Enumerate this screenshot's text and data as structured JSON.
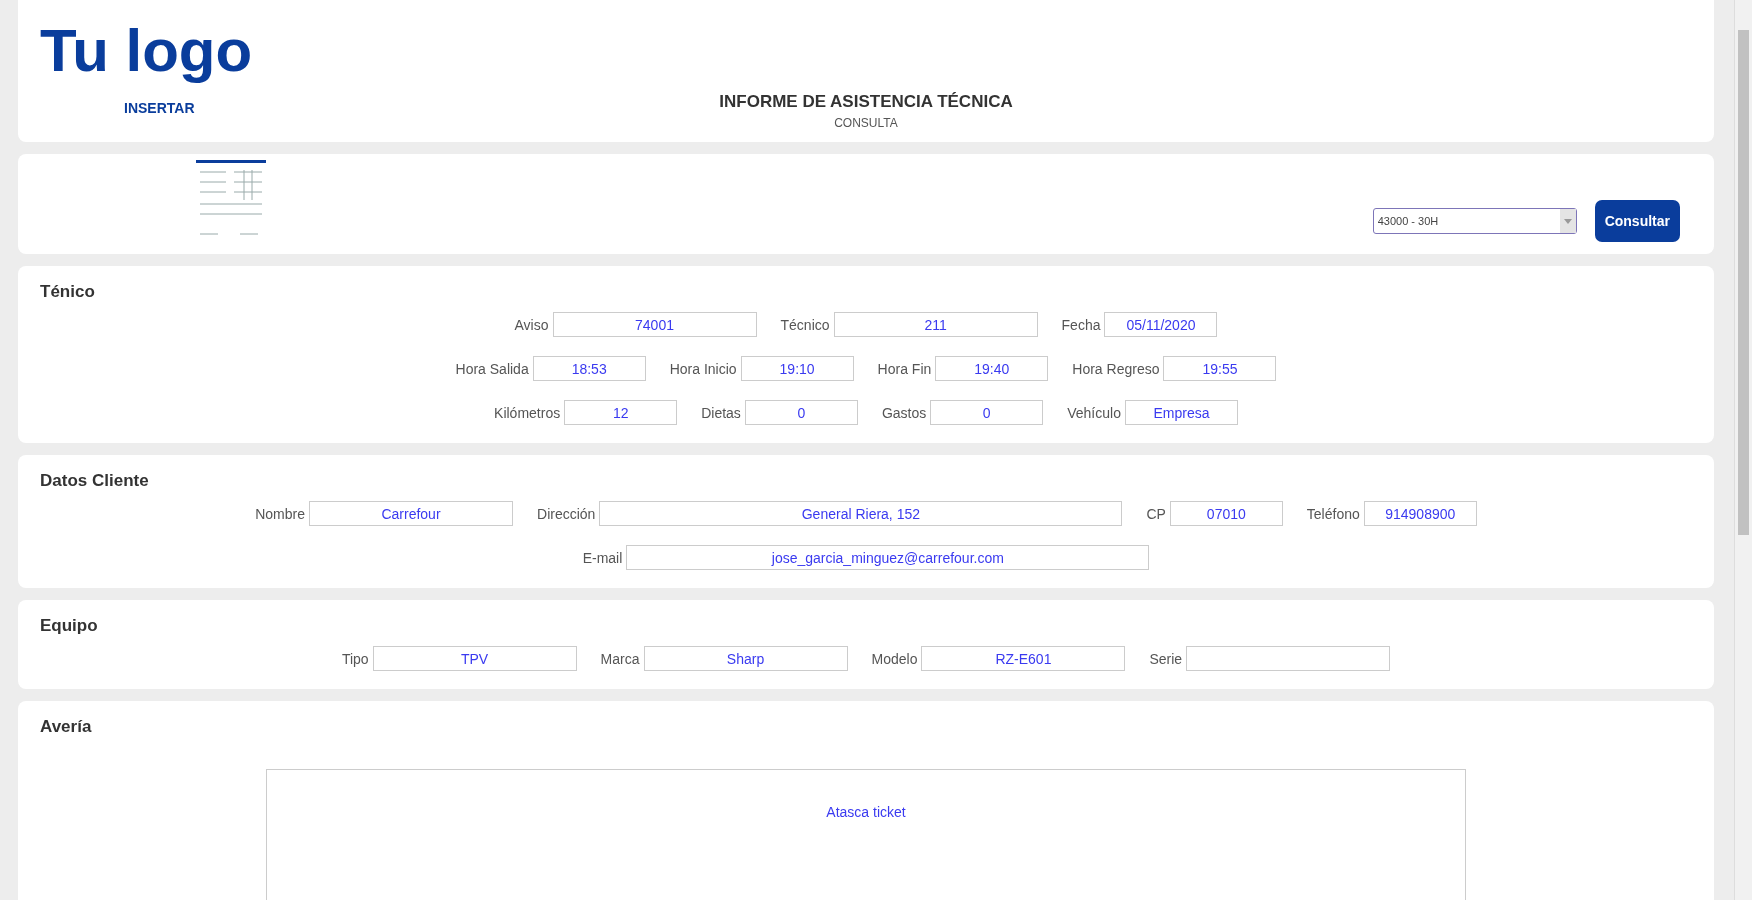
{
  "header": {
    "logo": "Tu logo",
    "insert_link": "INSERTAR",
    "title": "INFORME DE ASISTENCIA TÉCNICA",
    "subtitle": "CONSULTA"
  },
  "query": {
    "select_value": "43000 - 30H",
    "button": "Consultar"
  },
  "sections": [
    {
      "title": "Ténico",
      "lines": [
        {
          "fields": [
            {
              "label": "Aviso",
              "value": "74001",
              "kind": "medium"
            },
            {
              "label": "Técnico",
              "value": "211",
              "kind": "medium"
            },
            {
              "label": "Fecha",
              "value": "05/11/2020",
              "kind": "short"
            }
          ]
        },
        {
          "fields": [
            {
              "label": "Hora Salida",
              "value": "18:53",
              "kind": "short"
            },
            {
              "label": "Hora Inicio",
              "value": "19:10",
              "kind": "short"
            },
            {
              "label": "Hora Fin",
              "value": "19:40",
              "kind": "short"
            },
            {
              "label": "Hora Regreso",
              "value": "19:55",
              "kind": "short"
            }
          ]
        },
        {
          "fields": [
            {
              "label": "Kilómetros",
              "value": "12",
              "kind": "short"
            },
            {
              "label": "Dietas",
              "value": "0",
              "kind": "short"
            },
            {
              "label": "Gastos",
              "value": "0",
              "kind": "short"
            },
            {
              "label": "Vehículo",
              "value": "Empresa",
              "kind": "short"
            }
          ]
        }
      ]
    },
    {
      "title": "Datos Cliente",
      "lines": [
        {
          "fields": [
            {
              "label": "Nombre",
              "value": "Carrefour",
              "kind": "medium"
            },
            {
              "label": "Dirección",
              "value": "General Riera, 152",
              "kind": "wide"
            },
            {
              "label": "CP",
              "value": "07010",
              "kind": "short"
            },
            {
              "label": "Teléfono",
              "value": "914908900",
              "kind": "short"
            }
          ]
        },
        {
          "fields": [
            {
              "label": "E-mail",
              "value": "jose_garcia_minguez@carrefour.com",
              "kind": "wide"
            }
          ]
        }
      ]
    },
    {
      "title": "Equipo",
      "lines": [
        {
          "fields": [
            {
              "label": "Tipo",
              "value": "TPV",
              "kind": "medium"
            },
            {
              "label": "Marca",
              "value": "Sharp",
              "kind": "medium"
            },
            {
              "label": "Modelo",
              "value": "RZ-E601",
              "kind": "medium"
            },
            {
              "label": "Serie",
              "kind": "medium"
            }
          ]
        }
      ]
    }
  ],
  "fault": {
    "title": "Avería",
    "text": "Atasca ticket"
  }
}
